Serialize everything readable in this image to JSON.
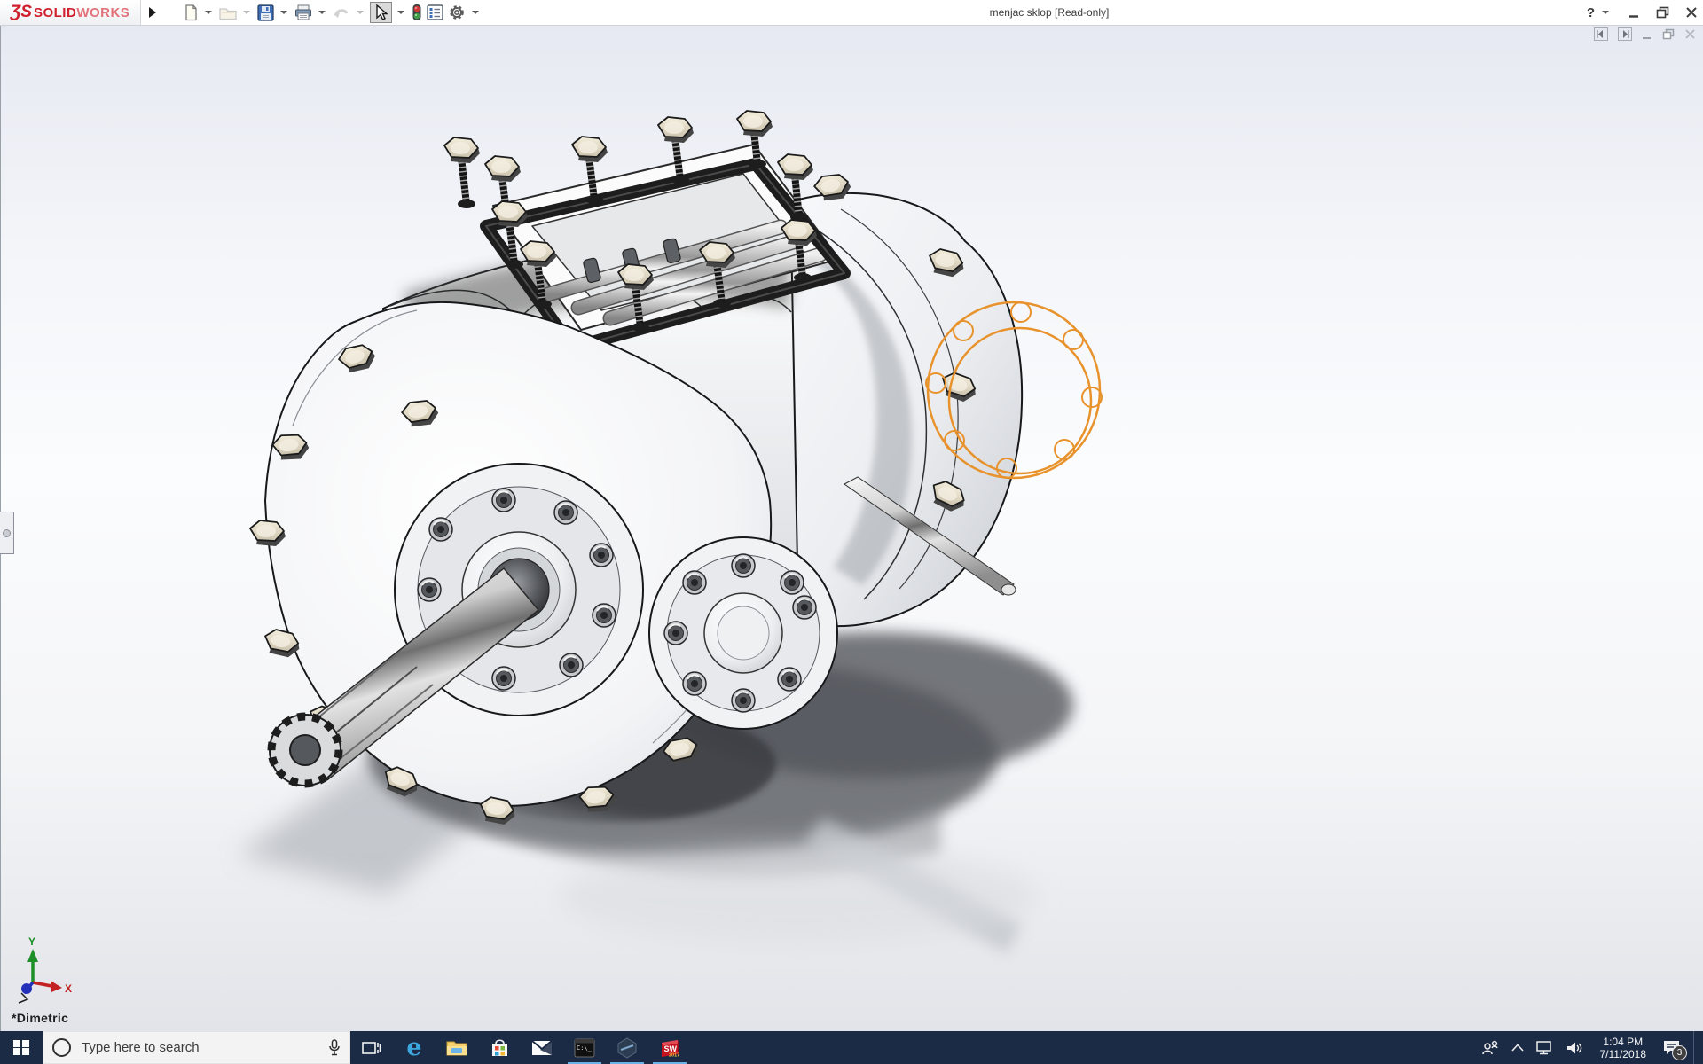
{
  "window": {
    "title": "menjac sklop [Read-only]",
    "help_label": "?"
  },
  "brand": {
    "logo_prefix": "ƷS",
    "logo_solid": "SOLID",
    "logo_works": "WORKS"
  },
  "toolbar": {
    "icons": [
      "new-document",
      "open",
      "save",
      "print",
      "undo",
      "select-tool",
      "interference-lights",
      "options-list",
      "settings-gear"
    ],
    "active_tool": "select-tool",
    "disabled_icons": [
      "open",
      "undo"
    ]
  },
  "document_window_controls": [
    "previous-view",
    "next-view",
    "minimize",
    "restore",
    "close"
  ],
  "viewport": {
    "model_name": "menjac sklop",
    "orientation_label": "*Dimetric",
    "triad": {
      "x_label": "X",
      "y_label": "Y"
    },
    "selection_highlight_color": "#E8922C"
  },
  "taskbar": {
    "search_placeholder": "Type here to search",
    "apps": [
      "start",
      "search",
      "task-view",
      "edge",
      "file-explorer",
      "store",
      "mail",
      "command-prompt",
      "solidworks-rx",
      "solidworks-2017"
    ],
    "running_apps": [
      "command-prompt",
      "solidworks-rx",
      "solidworks-2017"
    ],
    "cmd_glyph": "C:\\_",
    "edge_glyph": "e",
    "sw_glyph": "SW",
    "sw_year": "2017",
    "tray_icons": [
      "people",
      "chevron-up",
      "network",
      "volume",
      "clock",
      "action-center",
      "show-desktop"
    ],
    "clock": {
      "time": "1:04 PM",
      "date": "7/11/2018"
    },
    "notification_count": "3"
  },
  "colors": {
    "taskbar_bg": "#1b2a45",
    "running_indicator": "#6ab1e8",
    "logo_red": "#d0202e",
    "selection_orange": "#E8922C",
    "viewport_top": "#e6e9f1",
    "viewport_bottom": "#e2e4e9"
  }
}
